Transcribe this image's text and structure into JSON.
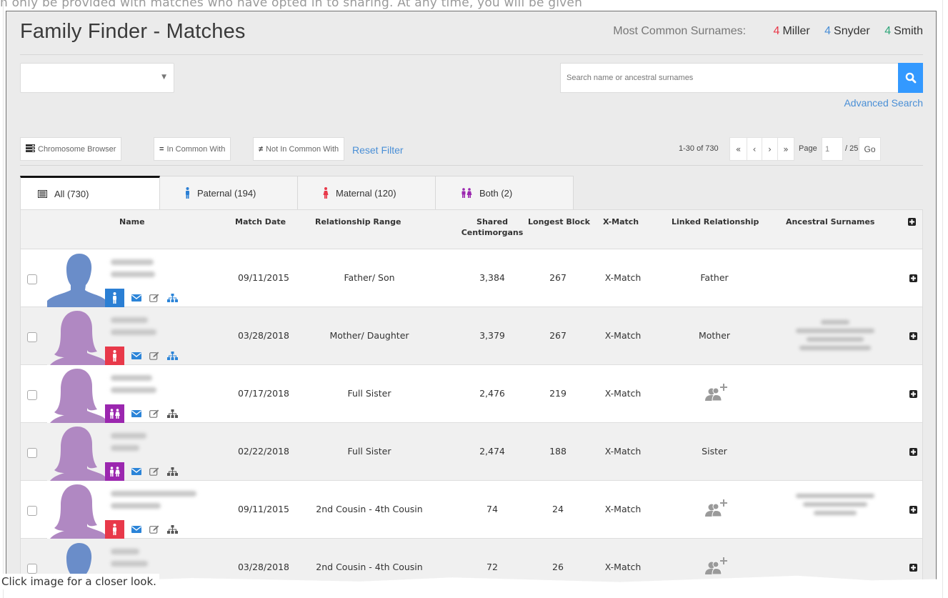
{
  "background": {
    "top_text": "n only be provided with matches who have opted in to sharing. At any time, you will be given",
    "caption": "Click image for a closer look."
  },
  "header": {
    "title": "Family Finder - Matches",
    "surnames_label": "Most Common Surnames:",
    "surnames": [
      {
        "count": "4",
        "name": "Miller",
        "color": "#e8394a"
      },
      {
        "count": "4",
        "name": "Snyder",
        "color": "#4a8fd6"
      },
      {
        "count": "4",
        "name": "Smith",
        "color": "#2fa67a"
      }
    ]
  },
  "controls": {
    "select_value": "",
    "search_placeholder": "Search name or ancestral surnames",
    "search_value": "",
    "search_button_icon": "search-icon",
    "advanced_search": "Advanced Search",
    "buttons": [
      {
        "icon": "chromosome-icon",
        "icon_glyph": "",
        "label": "Chromosome Browser"
      },
      {
        "icon": "equals-icon",
        "icon_glyph": "=",
        "label": "In Common With"
      },
      {
        "icon": "not-equal-icon",
        "icon_glyph": "≠",
        "label": "Not In Common With"
      }
    ],
    "reset_filter": "Reset Filter",
    "pagination": {
      "range": "1-30 of 730",
      "first": "«",
      "prev": "‹",
      "next": "›",
      "last": "»",
      "page_label": "Page",
      "page_value": "1",
      "total_pages": "/ 25",
      "go": "Go"
    }
  },
  "tabs": [
    {
      "label": "All (730)",
      "icon": "list-icon",
      "active": true
    },
    {
      "label": "Paternal (194)",
      "icon": "male-icon",
      "color": "#2b7fd4",
      "active": false
    },
    {
      "label": "Maternal (120)",
      "icon": "female-icon",
      "color": "#e8394a",
      "active": false
    },
    {
      "label": "Both (2)",
      "icon": "both-parents-icon",
      "color": "#9b27af",
      "active": false
    }
  ],
  "table": {
    "headers": {
      "name": "Name",
      "match_date": "Match Date",
      "relationship_range": "Relationship Range",
      "shared_cm_1": "Shared",
      "shared_cm_2": "Centimorgans",
      "longest_block": "Longest Block",
      "x_match": "X-Match",
      "linked_relationship": "Linked Relationship",
      "ancestral_surnames": "Ancestral Surnames"
    },
    "rows": [
      {
        "name": "[blurred]",
        "gender": "male",
        "side": "paternal",
        "match_date": "09/11/2015",
        "relationship_range": "Father/ Son",
        "shared_cm": "3,384",
        "longest_block": "267",
        "x_match": "X-Match",
        "linked_relationship": "Father",
        "has_link_button": false,
        "ancestral_surnames": "",
        "surnames_blurred": false
      },
      {
        "name": "[blurred]",
        "gender": "female",
        "side": "maternal",
        "match_date": "03/28/2018",
        "relationship_range": "Mother/ Daughter",
        "shared_cm": "3,379",
        "longest_block": "267",
        "x_match": "X-Match",
        "linked_relationship": "Mother",
        "has_link_button": false,
        "ancestral_surnames": "[blurred]",
        "surnames_blurred": true
      },
      {
        "name": "[blurred]",
        "gender": "female",
        "side": "both",
        "match_date": "07/17/2018",
        "relationship_range": "Full Sister",
        "shared_cm": "2,476",
        "longest_block": "219",
        "x_match": "X-Match",
        "linked_relationship": "",
        "has_link_button": true,
        "ancestral_surnames": "",
        "surnames_blurred": false
      },
      {
        "name": "[blurred]",
        "gender": "female",
        "side": "both",
        "match_date": "02/22/2018",
        "relationship_range": "Full Sister",
        "shared_cm": "2,474",
        "longest_block": "188",
        "x_match": "X-Match",
        "linked_relationship": "Sister",
        "has_link_button": false,
        "ancestral_surnames": "",
        "surnames_blurred": false
      },
      {
        "name": "[blurred]",
        "gender": "female",
        "side": "maternal",
        "match_date": "09/11/2015",
        "relationship_range": "2nd Cousin - 4th Cousin",
        "shared_cm": "74",
        "longest_block": "24",
        "x_match": "X-Match",
        "linked_relationship": "",
        "has_link_button": true,
        "ancestral_surnames": "[blurred]",
        "surnames_blurred": true
      },
      {
        "name": "[blurred]",
        "gender": "male",
        "side": "maternal",
        "match_date": "03/28/2018",
        "relationship_range": "2nd Cousin - 4th Cousin",
        "shared_cm": "72",
        "longest_block": "26",
        "x_match": "X-Match",
        "linked_relationship": "",
        "has_link_button": true,
        "ancestral_surnames": "",
        "surnames_blurred": false
      }
    ]
  },
  "colors": {
    "accent_blue": "#3399ff",
    "link_blue": "#4a8fd6",
    "paternal": "#2b7fd4",
    "maternal": "#e8394a",
    "both": "#9b27af",
    "male_avatar": "#6a8dc9",
    "female_avatar": "#b088c2"
  }
}
